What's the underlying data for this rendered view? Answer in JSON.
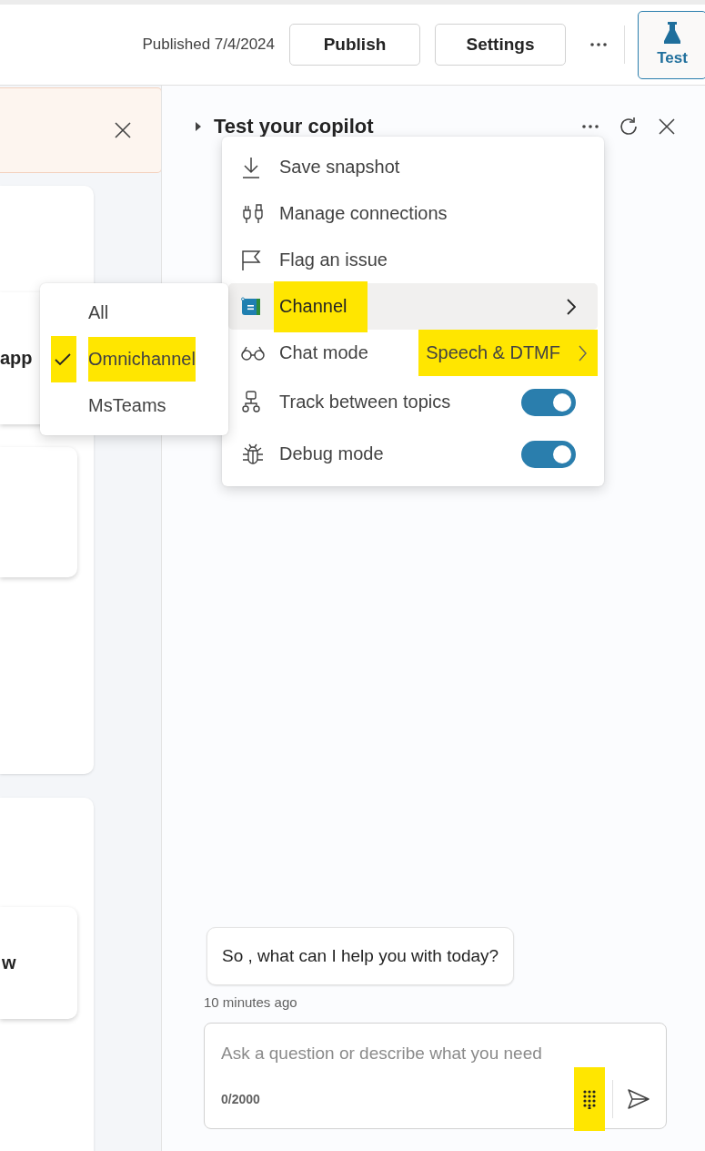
{
  "top_bar": {
    "published": "Published 7/4/2024",
    "buttons": [
      {
        "label": "Publish"
      },
      {
        "label": "Settings"
      }
    ],
    "test_button": {
      "label": "Test",
      "selected": true
    }
  },
  "left_pane": {
    "cards": [
      {
        "text": "app"
      },
      {
        "text": "w"
      }
    ]
  },
  "test_panel": {
    "title": "Test your copilot",
    "message": "So , what can I help you with today?",
    "timestamp": "10 minutes ago",
    "input": {
      "placeholder": "Ask a question or describe what you need",
      "counter": "0/2000"
    },
    "dialpad_highlighted": true
  },
  "options_menu": {
    "items": [
      {
        "kind": "action",
        "label": "Save snapshot",
        "hovered": false,
        "highlighted": false
      },
      {
        "kind": "action",
        "label": "Manage connections",
        "hovered": false,
        "highlighted": false
      },
      {
        "kind": "action",
        "label": "Flag an issue",
        "hovered": false,
        "highlighted": false
      },
      {
        "kind": "submenu",
        "label": "Channel",
        "hovered": true,
        "highlighted": true
      },
      {
        "kind": "value",
        "label": "Chat mode",
        "value": "Speech & DTMF",
        "hovered": false,
        "highlighted": true
      },
      {
        "kind": "toggle",
        "label": "Track between topics",
        "on": true,
        "hovered": false,
        "highlighted": false
      },
      {
        "kind": "toggle",
        "label": "Debug mode",
        "on": true,
        "hovered": false,
        "highlighted": false
      }
    ]
  },
  "channel_submenu": {
    "options": [
      {
        "label": "All",
        "selected": false,
        "highlighted": false
      },
      {
        "label": "Omnichannel",
        "selected": true,
        "highlighted": true
      },
      {
        "label": "MsTeams",
        "selected": false,
        "highlighted": false
      }
    ]
  }
}
